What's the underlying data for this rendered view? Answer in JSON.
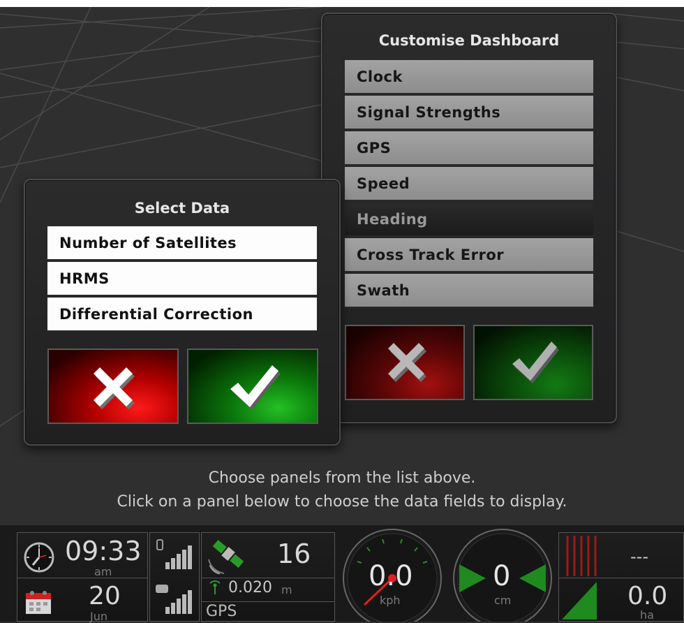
{
  "customise_dashboard": {
    "title": "Customise Dashboard",
    "items": [
      {
        "label": "Clock"
      },
      {
        "label": "Signal Strengths"
      },
      {
        "label": "GPS"
      },
      {
        "label": "Speed"
      },
      {
        "label": "Heading",
        "selected": true
      },
      {
        "label": "Cross Track Error"
      },
      {
        "label": "Swath"
      }
    ]
  },
  "select_data": {
    "title": "Select Data",
    "items": [
      {
        "label": "Number of Satellites"
      },
      {
        "label": "HRMS"
      },
      {
        "label": "Differential Correction"
      }
    ]
  },
  "hint": {
    "line1": "Choose panels from the list above.",
    "line2": "Click on a panel below to choose the data fields to display."
  },
  "dashboard": {
    "clock": {
      "time": "09:33",
      "ampm": "am",
      "day": "20",
      "month": "Jun"
    },
    "gps": {
      "satellites": "16",
      "hrms": "0.020",
      "hrms_unit": "m",
      "label": "GPS"
    },
    "speed": {
      "value": "0.0",
      "unit": "kph"
    },
    "cross_track": {
      "value": "0",
      "unit": "cm"
    },
    "swath": {
      "top": "---",
      "area": "0.0",
      "area_unit": "ha"
    }
  },
  "colors": {
    "cancel": "#e00000",
    "confirm": "#16a816",
    "selected_row": "#222222"
  }
}
